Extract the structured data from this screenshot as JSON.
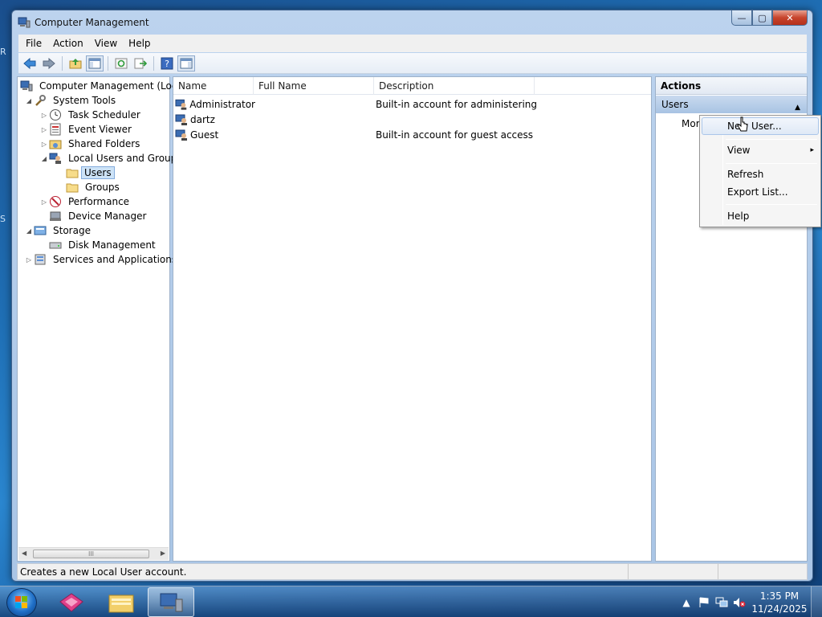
{
  "desktop": {
    "left_glyphs": [
      "R",
      "S"
    ]
  },
  "window": {
    "title": "Computer Management",
    "controls": {
      "minimize": "—",
      "maximize": "▢",
      "close": "✕"
    }
  },
  "menubar": [
    "File",
    "Action",
    "View",
    "Help"
  ],
  "toolbar": {
    "buttons": [
      "back-icon",
      "forward-icon",
      "up-folder-icon",
      "show-hide-tree-icon",
      "refresh-icon",
      "export-list-icon",
      "help-icon",
      "show-hide-action-pane-icon"
    ]
  },
  "tree": {
    "items": [
      {
        "label": "Computer Management (Local",
        "icon": "computer-management-icon"
      },
      {
        "label": "System Tools",
        "icon": "system-tools-icon",
        "expander": "◢"
      },
      {
        "label": "Task Scheduler",
        "icon": "clock-icon",
        "expander": "▷"
      },
      {
        "label": "Event Viewer",
        "icon": "event-viewer-icon",
        "expander": "▷"
      },
      {
        "label": "Shared Folders",
        "icon": "shared-folder-icon",
        "expander": "▷"
      },
      {
        "label": "Local Users and Groups",
        "icon": "users-groups-icon",
        "expander": "◢"
      },
      {
        "label": "Users",
        "icon": "folder-icon"
      },
      {
        "label": "Groups",
        "icon": "folder-icon"
      },
      {
        "label": "Performance",
        "icon": "performance-icon",
        "expander": "▷"
      },
      {
        "label": "Device Manager",
        "icon": "device-manager-icon"
      },
      {
        "label": "Storage",
        "icon": "storage-icon",
        "expander": "◢"
      },
      {
        "label": "Disk Management",
        "icon": "disk-icon"
      },
      {
        "label": "Services and Applications",
        "icon": "services-icon",
        "expander": "▷"
      }
    ],
    "scroll_grip": "III"
  },
  "list": {
    "columns": [
      "Name",
      "Full Name",
      "Description"
    ],
    "rows": [
      {
        "name": "Administrator",
        "full_name": "",
        "description": "Built-in account for administering..."
      },
      {
        "name": "dartz",
        "full_name": "",
        "description": ""
      },
      {
        "name": "Guest",
        "full_name": "",
        "description": "Built-in account for guest access t..."
      }
    ]
  },
  "actions": {
    "title": "Actions",
    "section": "Users",
    "section_caret": "▲",
    "more": "Mor"
  },
  "context_menu": {
    "items": [
      "New User...",
      "View",
      "Refresh",
      "Export List...",
      "Help"
    ],
    "submenu_arrow": "▸",
    "highlighted": "New User..."
  },
  "statusbar": {
    "text": "Creates a new Local User account."
  },
  "taskbar": {
    "apps": [
      "start-orb",
      "paint-app-icon",
      "explorer-app-icon",
      "computer-management-app-icon"
    ],
    "clock_time": "1:35 PM",
    "clock_date": "11/24/2025",
    "tray": {
      "show_hidden": "▲"
    }
  },
  "colors": {
    "selection": "#cde3f7",
    "window_frame": "#bcd3ee",
    "close_button": "#c7442c",
    "taskbar": "#2a5a8f"
  }
}
